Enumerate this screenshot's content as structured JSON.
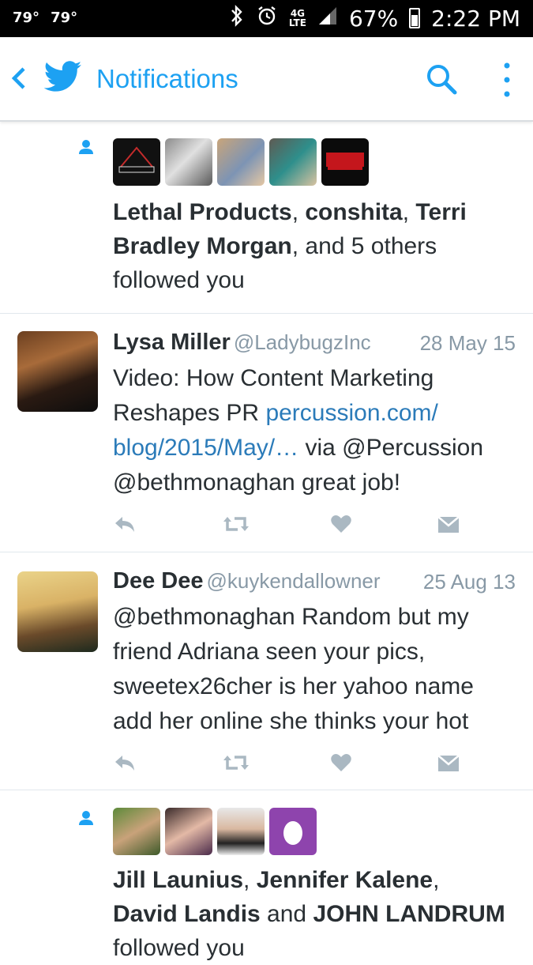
{
  "status": {
    "temp1": "79°",
    "temp2": "79°",
    "battery": "67%",
    "time": "2:22 PM",
    "network": "4G",
    "network_sub": "LTE"
  },
  "header": {
    "title": "Notifications"
  },
  "follow1": {
    "name1": "Lethal Products",
    "sep1": ", ",
    "name2": "conshita",
    "sep2": ", ",
    "name3": "Terri Bradley Morgan",
    "rest": ", and 5 others followed you"
  },
  "tweet1": {
    "name": "Lysa Miller",
    "handle": "@LadybugzInc",
    "date": "28 May 15",
    "text1": "Video: How Content Marketing Reshapes PR ",
    "link": "percussion.com/ blog/2015/May/…",
    "text2": " via @Percussion @bethmonaghan great job!"
  },
  "tweet2": {
    "name": "Dee Dee",
    "handle": "@kuykendallowner",
    "date": "25 Aug 13",
    "text": "@bethmonaghan Random but my friend Adriana seen your pics, sweetex26cher is her yahoo name add her online she thinks your hot"
  },
  "follow2": {
    "name1": "Jill Launius",
    "sep1": ", ",
    "name2": "Jennifer Kalene",
    "sep2": ", ",
    "name3": "David Landis",
    "mid": " and ",
    "name4": "JOHN LANDRUM",
    "rest": " followed you"
  },
  "colors": {
    "accent": "#1da1f2",
    "text": "#292f33",
    "muted": "#8899a6",
    "link": "#2b7bb9",
    "icon": "#aab8c2"
  }
}
